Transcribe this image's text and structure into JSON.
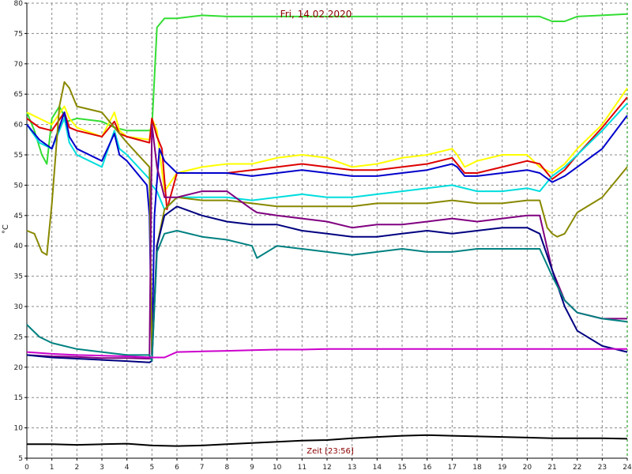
{
  "chart_data": {
    "type": "line",
    "title": "Fri, 14.02.2020",
    "xlabel": "Zeit [23:56]",
    "ylabel": "°C",
    "xlim": [
      0,
      24
    ],
    "ylim": [
      5,
      80
    ],
    "xticks": [
      0,
      1,
      2,
      3,
      4,
      5,
      6,
      7,
      8,
      9,
      10,
      11,
      12,
      13,
      14,
      15,
      16,
      17,
      18,
      19,
      20,
      21,
      22,
      23,
      24
    ],
    "yticks": [
      5,
      10,
      15,
      20,
      25,
      30,
      35,
      40,
      45,
      50,
      55,
      60,
      65,
      70,
      75,
      80
    ],
    "grid": true,
    "series": [
      {
        "color": "#33dd33",
        "x": [
          0,
          0.3,
          0.6,
          0.8,
          1.0,
          1.3,
          1.6,
          2,
          3,
          3.5,
          4,
          4.9,
          5.0,
          5.2,
          5.5,
          6,
          7,
          8,
          9,
          10,
          11,
          12,
          13,
          14,
          15,
          16,
          17,
          18,
          19,
          20,
          20.5,
          21,
          21.5,
          22,
          23,
          24
        ],
        "y": [
          62,
          59,
          55,
          53.5,
          61,
          63,
          60.5,
          61,
          60.5,
          59.5,
          59,
          59,
          59.5,
          76,
          77.5,
          77.5,
          78,
          77.8,
          77.8,
          77.8,
          77.8,
          77.8,
          77.8,
          77.8,
          77.8,
          77.8,
          77.8,
          77.8,
          77.8,
          77.8,
          77.8,
          77,
          77,
          77.8,
          78,
          78.2
        ]
      },
      {
        "color": "#ffff00",
        "x": [
          0,
          0.5,
          1,
          1.5,
          1.7,
          2,
          3,
          3.5,
          3.7,
          4,
          4.9,
          5,
          5.2,
          5.5,
          6,
          7,
          8,
          9,
          10,
          11,
          12,
          13,
          14,
          15,
          16,
          17,
          17.2,
          17.5,
          18,
          19,
          20,
          20.5,
          21,
          21.5,
          22,
          23,
          24
        ],
        "y": [
          62,
          61,
          60,
          63,
          61,
          59.5,
          58,
          62,
          59,
          58,
          57.5,
          61,
          59,
          49,
          52,
          53,
          53.5,
          53.5,
          54.5,
          55,
          54.5,
          53,
          53.5,
          54.5,
          55,
          56,
          55,
          53,
          54,
          55,
          55,
          53,
          52,
          53.5,
          56,
          60,
          66
        ]
      },
      {
        "color": "#dd0000",
        "x": [
          0,
          0.5,
          1,
          1.5,
          1.7,
          2,
          3,
          3.5,
          3.7,
          4,
          4.9,
          5,
          5.2,
          5.4,
          5.6,
          6,
          7,
          8,
          9,
          10,
          11,
          12,
          13,
          14,
          15,
          16,
          17,
          17.2,
          17.5,
          18,
          19,
          20,
          20.5,
          21,
          21.5,
          22,
          23,
          24
        ],
        "y": [
          61,
          59.5,
          59,
          62,
          59.5,
          59,
          58,
          60.5,
          58.5,
          58,
          57,
          61,
          58,
          56,
          46,
          52,
          52,
          52,
          52.5,
          53,
          53.5,
          53,
          52.5,
          52.5,
          53,
          53.5,
          54.5,
          53.5,
          52,
          52,
          53,
          54,
          53.5,
          51,
          52.5,
          55,
          59.5,
          64.5
        ]
      },
      {
        "color": "#00dddd",
        "x": [
          0,
          0.5,
          1,
          1.5,
          1.7,
          2,
          3,
          3.5,
          3.7,
          4,
          4.9,
          5,
          5.2,
          5.5,
          6,
          7,
          8,
          9,
          10,
          11,
          12,
          13,
          14,
          15,
          16,
          17,
          18,
          19,
          20,
          20.5,
          21,
          21.5,
          22,
          23,
          24
        ],
        "y": [
          60,
          57,
          56,
          61,
          57,
          55,
          53,
          59,
          56,
          55,
          51,
          50,
          49,
          46,
          48,
          48,
          48,
          47.5,
          48,
          48.5,
          48,
          48,
          48.5,
          49,
          49.5,
          50,
          49,
          49,
          49.5,
          49,
          51.5,
          53,
          55,
          59,
          63.5
        ]
      },
      {
        "color": "#0000cc",
        "x": [
          0,
          0.5,
          1,
          1.5,
          1.7,
          2,
          3,
          3.5,
          3.7,
          4,
          4.8,
          4.9,
          5,
          5.1,
          5.3,
          5.5,
          6,
          7,
          8,
          9,
          10,
          11,
          12,
          13,
          14,
          15,
          16,
          17,
          17.2,
          17.5,
          18,
          19,
          20,
          20.5,
          21,
          21.5,
          22,
          23,
          24
        ],
        "y": [
          60,
          57.5,
          56,
          62,
          58,
          56,
          54,
          58.5,
          55,
          54,
          50,
          45,
          22,
          45,
          56,
          54,
          52,
          52,
          52,
          51.5,
          52,
          52.5,
          52,
          51.5,
          51.5,
          52,
          52.5,
          53.5,
          53,
          51.5,
          51.5,
          52,
          52.5,
          52,
          50.5,
          51.5,
          53,
          56,
          61.5
        ]
      },
      {
        "color": "#888800",
        "x": [
          0,
          0.3,
          0.6,
          0.8,
          1,
          1.3,
          1.5,
          1.7,
          2,
          3,
          4,
          4.9,
          5,
          5.2,
          5.5,
          6,
          7,
          8,
          9,
          10,
          11,
          12,
          13,
          14,
          15,
          16,
          17,
          18,
          19,
          20,
          20.5,
          20.8,
          21,
          21.2,
          21.5,
          22,
          23,
          24
        ],
        "y": [
          42.5,
          42,
          39,
          38.5,
          47,
          63,
          67,
          66,
          63,
          62,
          57,
          53,
          22,
          40,
          46,
          48,
          47.5,
          47.5,
          47,
          46.5,
          46.5,
          46.5,
          46.5,
          47,
          47,
          47,
          47.5,
          47,
          47,
          47.5,
          47.5,
          43,
          42,
          41.5,
          42,
          45.5,
          48,
          53
        ]
      },
      {
        "color": "#800080",
        "x": [
          0,
          0.5,
          1,
          2,
          3,
          4,
          4.9,
          5,
          5.2,
          5.5,
          6,
          7,
          8,
          9,
          9.2,
          10,
          11,
          12,
          13,
          14,
          15,
          16,
          17,
          18,
          19,
          20,
          20.5,
          21,
          21.5,
          22,
          23,
          24
        ],
        "y": [
          22,
          21.9,
          21.8,
          21.7,
          21.5,
          21.5,
          21.4,
          60,
          53,
          48,
          48,
          49,
          49,
          46,
          45.5,
          45,
          44.5,
          44,
          43,
          43.5,
          43.5,
          44,
          44.5,
          44,
          44.5,
          45,
          45,
          36,
          31,
          29,
          28,
          28
        ]
      },
      {
        "color": "#000080",
        "x": [
          0,
          0.5,
          1,
          2,
          3,
          4,
          4.9,
          5,
          5.2,
          5.5,
          6,
          7,
          8,
          9,
          10,
          11,
          12,
          13,
          14,
          15,
          16,
          17,
          18,
          19,
          20,
          20.5,
          21,
          21.5,
          22,
          23,
          24
        ],
        "y": [
          22,
          21.8,
          21.6,
          21.4,
          21.2,
          21,
          20.8,
          21,
          40,
          45,
          46.5,
          45,
          44,
          43.5,
          43.5,
          42.5,
          42,
          41.5,
          41.5,
          42,
          42.5,
          42,
          42.5,
          43,
          43,
          42,
          36,
          30,
          26,
          23.5,
          22.5
        ]
      },
      {
        "color": "#008080",
        "x": [
          0,
          0.5,
          1,
          2,
          3,
          4,
          4.9,
          5,
          5.2,
          5.5,
          6,
          7,
          8,
          9,
          9.2,
          10,
          11,
          12,
          13,
          14,
          15,
          16,
          17,
          18,
          19,
          20,
          20.5,
          21,
          21.5,
          22,
          23,
          24
        ],
        "y": [
          27,
          25,
          24,
          23,
          22.5,
          22,
          22,
          21,
          39,
          42,
          42.5,
          41.5,
          41,
          40,
          38,
          40,
          39.5,
          39,
          38.5,
          39,
          39.5,
          39,
          39,
          39.5,
          39.5,
          39.5,
          39.5,
          35,
          31,
          29,
          28,
          27.5
        ]
      },
      {
        "color": "#cc00cc",
        "x": [
          0,
          1,
          2,
          3,
          4,
          5,
          5.5,
          6,
          7,
          8,
          9,
          10,
          11,
          12,
          13,
          14,
          15,
          16,
          17,
          18,
          19,
          20,
          21,
          22,
          23,
          24
        ],
        "y": [
          22.5,
          22.2,
          22,
          21.9,
          21.8,
          21.6,
          21.6,
          22.5,
          22.6,
          22.7,
          22.8,
          22.9,
          22.9,
          23,
          23,
          23,
          23,
          23,
          23,
          23,
          23,
          23,
          23,
          23,
          23,
          23
        ]
      },
      {
        "color": "#000000",
        "x": [
          0,
          1,
          2,
          3,
          4,
          5,
          6,
          7,
          8,
          9,
          10,
          11,
          12,
          13,
          14,
          15,
          16,
          17,
          18,
          19,
          20,
          21,
          22,
          23,
          24
        ],
        "y": [
          7.3,
          7.3,
          7.2,
          7.3,
          7.4,
          7.1,
          7.0,
          7.1,
          7.3,
          7.5,
          7.7,
          7.9,
          8.0,
          8.3,
          8.5,
          8.7,
          8.8,
          8.7,
          8.6,
          8.5,
          8.4,
          8.3,
          8.3,
          8.3,
          8.2
        ]
      }
    ]
  }
}
